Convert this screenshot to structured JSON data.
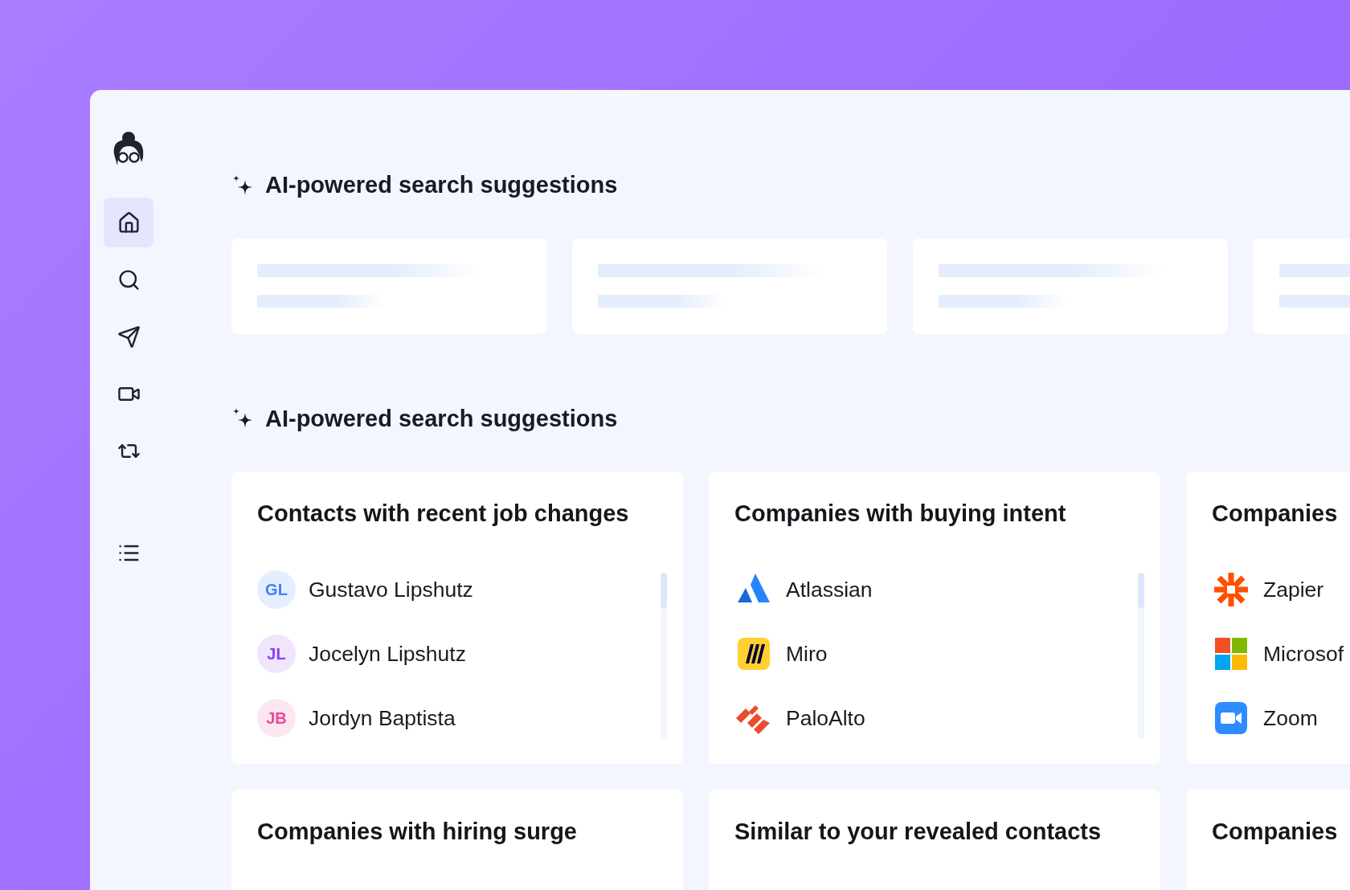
{
  "sidebar": {
    "items": [
      {
        "kind": "home",
        "selected": true
      },
      {
        "kind": "search",
        "selected": false
      },
      {
        "kind": "send",
        "selected": false
      },
      {
        "kind": "video",
        "selected": false
      },
      {
        "kind": "repeat",
        "selected": false
      },
      {
        "kind": "list",
        "selected": false
      }
    ]
  },
  "loading_section": {
    "title": "AI-powered search suggestions"
  },
  "suggestions_section": {
    "title": "AI-powered search suggestions",
    "cards": [
      {
        "title": "Contacts with recent job changes",
        "items": [
          {
            "kind": "person",
            "initials": "GL",
            "color": "#3b82f6",
            "name": "Gustavo Lipshutz"
          },
          {
            "kind": "person",
            "initials": "JL",
            "color": "#8b3df0",
            "name": "Jocelyn Lipshutz"
          },
          {
            "kind": "person",
            "initials": "JB",
            "color": "#ec4899",
            "name": "Jordyn Baptista"
          }
        ]
      },
      {
        "title": "Companies with buying intent",
        "items": [
          {
            "kind": "company",
            "name": "Atlassian"
          },
          {
            "kind": "company",
            "name": "Miro"
          },
          {
            "kind": "company",
            "name": "PaloAlto"
          }
        ]
      },
      {
        "title": "Companies",
        "items": [
          {
            "kind": "company",
            "name": "Zapier"
          },
          {
            "kind": "company",
            "name": "Microsof"
          },
          {
            "kind": "company",
            "name": "Zoom"
          }
        ]
      },
      {
        "title": "Companies with hiring surge"
      },
      {
        "title": "Similar to your revealed contacts"
      },
      {
        "title": "Companies"
      }
    ]
  }
}
